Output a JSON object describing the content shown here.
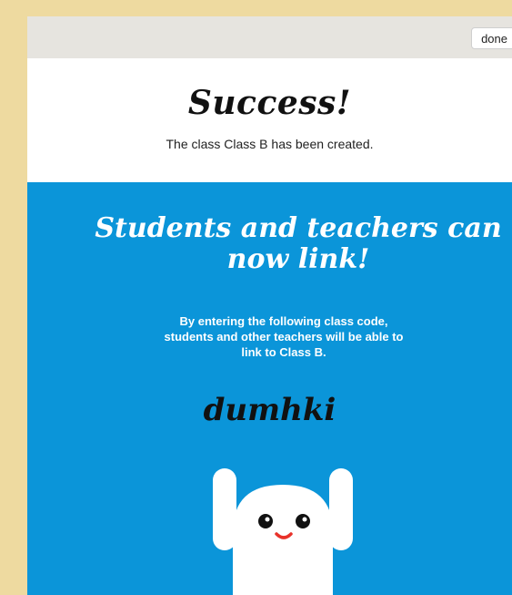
{
  "topbar": {
    "done_label": "done"
  },
  "success": {
    "title": "Success!",
    "message": "The class Class B has been created."
  },
  "info": {
    "headline_line1": "Students and teachers can",
    "headline_line2": "now link!",
    "desc_line1": "By entering the following class code,",
    "desc_line2": "students and other teachers will be able to",
    "desc_line3": "link to Class B.",
    "class_code": "dumhki"
  },
  "colors": {
    "background": "#eedaa0",
    "topbar": "#e6e4df",
    "accent_blue": "#0b95d9",
    "mouth": "#e8322a"
  },
  "mascot": {
    "icon": "waving-ghost-mascot-icon"
  }
}
